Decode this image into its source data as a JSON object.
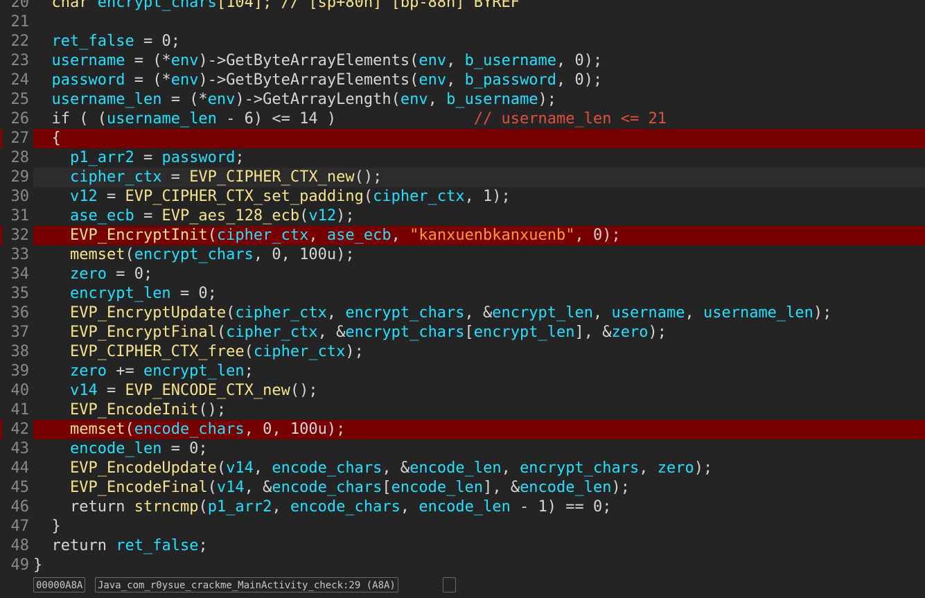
{
  "editor": {
    "lines": [
      {
        "n": "20",
        "bp": false,
        "cur": false,
        "tokens": [
          [
            "  ",
            "op"
          ],
          [
            "char ",
            "ty"
          ],
          [
            "encrypt_chars",
            "var"
          ],
          [
            "[104]; // [sp+80h] [bp-88h] BYREF",
            "fn"
          ]
        ]
      },
      {
        "n": "21",
        "bp": false,
        "cur": false,
        "tokens": []
      },
      {
        "n": "22",
        "bp": false,
        "cur": false,
        "tokens": [
          [
            "  ",
            "op"
          ],
          [
            "ret_false",
            "var"
          ],
          [
            " = 0;",
            "op"
          ]
        ]
      },
      {
        "n": "23",
        "bp": false,
        "cur": false,
        "tokens": [
          [
            "  ",
            "op"
          ],
          [
            "username",
            "var"
          ],
          [
            " = (*",
            "op"
          ],
          [
            "env",
            "var"
          ],
          [
            ")->GetByteArrayElements(",
            "op"
          ],
          [
            "env",
            "var"
          ],
          [
            ", ",
            "op"
          ],
          [
            "b_username",
            "var"
          ],
          [
            ", 0);",
            "op"
          ]
        ]
      },
      {
        "n": "24",
        "bp": false,
        "cur": false,
        "tokens": [
          [
            "  ",
            "op"
          ],
          [
            "password",
            "var"
          ],
          [
            " = (*",
            "op"
          ],
          [
            "env",
            "var"
          ],
          [
            ")->GetByteArrayElements(",
            "op"
          ],
          [
            "env",
            "var"
          ],
          [
            ", ",
            "op"
          ],
          [
            "b_password",
            "var"
          ],
          [
            ", 0);",
            "op"
          ]
        ]
      },
      {
        "n": "25",
        "bp": false,
        "cur": false,
        "tokens": [
          [
            "  ",
            "op"
          ],
          [
            "username_len",
            "var"
          ],
          [
            " = (*",
            "op"
          ],
          [
            "env",
            "var"
          ],
          [
            ")->GetArrayLength(",
            "op"
          ],
          [
            "env",
            "var"
          ],
          [
            ", ",
            "op"
          ],
          [
            "b_username",
            "var"
          ],
          [
            ");",
            "op"
          ]
        ]
      },
      {
        "n": "26",
        "bp": false,
        "cur": false,
        "tokens": [
          [
            "  ",
            "op"
          ],
          [
            "if",
            "kw"
          ],
          [
            " ( (",
            "op"
          ],
          [
            "username_len",
            "var"
          ],
          [
            " - 6) <= 14 )               ",
            "op"
          ],
          [
            "// username_len <= 21",
            "cm"
          ]
        ]
      },
      {
        "n": "27",
        "bp": true,
        "cur": false,
        "tokens": [
          [
            "  {",
            "op"
          ]
        ]
      },
      {
        "n": "28",
        "bp": false,
        "cur": false,
        "tokens": [
          [
            "    ",
            "op"
          ],
          [
            "p1_arr2",
            "var"
          ],
          [
            " = ",
            "op"
          ],
          [
            "password",
            "var"
          ],
          [
            ";",
            "op"
          ]
        ]
      },
      {
        "n": "29",
        "bp": false,
        "cur": true,
        "tokens": [
          [
            "    ",
            "op"
          ],
          [
            "cipher_ctx",
            "var"
          ],
          [
            " = ",
            "op"
          ],
          [
            "EVP_CIPHER_CTX_new",
            "fn"
          ],
          [
            "();",
            "op"
          ]
        ]
      },
      {
        "n": "30",
        "bp": false,
        "cur": false,
        "tokens": [
          [
            "    ",
            "op"
          ],
          [
            "v12",
            "var"
          ],
          [
            " = ",
            "op"
          ],
          [
            "EVP_CIPHER_CTX_set_padding",
            "fn"
          ],
          [
            "(",
            "op"
          ],
          [
            "cipher_ctx",
            "var"
          ],
          [
            ", 1);",
            "op"
          ]
        ]
      },
      {
        "n": "31",
        "bp": false,
        "cur": false,
        "tokens": [
          [
            "    ",
            "op"
          ],
          [
            "ase_ecb",
            "var"
          ],
          [
            " = ",
            "op"
          ],
          [
            "EVP_aes_128_ecb",
            "fn"
          ],
          [
            "(",
            "op"
          ],
          [
            "v12",
            "var"
          ],
          [
            ");",
            "op"
          ]
        ]
      },
      {
        "n": "32",
        "bp": true,
        "cur": false,
        "tokens": [
          [
            "    ",
            "op"
          ],
          [
            "EVP_EncryptInit",
            "fn"
          ],
          [
            "(",
            "op"
          ],
          [
            "cipher_ctx",
            "var"
          ],
          [
            ", ",
            "op"
          ],
          [
            "ase_ecb",
            "var"
          ],
          [
            ", ",
            "op"
          ],
          [
            "\"kanxuenbkanxuenb\"",
            "str"
          ],
          [
            ", 0);",
            "op"
          ]
        ]
      },
      {
        "n": "33",
        "bp": false,
        "cur": false,
        "tokens": [
          [
            "    ",
            "op"
          ],
          [
            "memset",
            "fn"
          ],
          [
            "(",
            "op"
          ],
          [
            "encrypt_chars",
            "var"
          ],
          [
            ", 0, 100u);",
            "op"
          ]
        ]
      },
      {
        "n": "34",
        "bp": false,
        "cur": false,
        "tokens": [
          [
            "    ",
            "op"
          ],
          [
            "zero",
            "var"
          ],
          [
            " = 0;",
            "op"
          ]
        ]
      },
      {
        "n": "35",
        "bp": false,
        "cur": false,
        "tokens": [
          [
            "    ",
            "op"
          ],
          [
            "encrypt_len",
            "var"
          ],
          [
            " = 0;",
            "op"
          ]
        ]
      },
      {
        "n": "36",
        "bp": false,
        "cur": false,
        "tokens": [
          [
            "    ",
            "op"
          ],
          [
            "EVP_EncryptUpdate",
            "fn"
          ],
          [
            "(",
            "op"
          ],
          [
            "cipher_ctx",
            "var"
          ],
          [
            ", ",
            "op"
          ],
          [
            "encrypt_chars",
            "var"
          ],
          [
            ", &",
            "op"
          ],
          [
            "encrypt_len",
            "var"
          ],
          [
            ", ",
            "op"
          ],
          [
            "username",
            "var"
          ],
          [
            ", ",
            "op"
          ],
          [
            "username_len",
            "var"
          ],
          [
            ");",
            "op"
          ]
        ]
      },
      {
        "n": "37",
        "bp": false,
        "cur": false,
        "tokens": [
          [
            "    ",
            "op"
          ],
          [
            "EVP_EncryptFinal",
            "fn"
          ],
          [
            "(",
            "op"
          ],
          [
            "cipher_ctx",
            "var"
          ],
          [
            ", &",
            "op"
          ],
          [
            "encrypt_chars",
            "var"
          ],
          [
            "[",
            "op"
          ],
          [
            "encrypt_len",
            "var"
          ],
          [
            "], &",
            "op"
          ],
          [
            "zero",
            "var"
          ],
          [
            ");",
            "op"
          ]
        ]
      },
      {
        "n": "38",
        "bp": false,
        "cur": false,
        "tokens": [
          [
            "    ",
            "op"
          ],
          [
            "EVP_CIPHER_CTX_free",
            "fn"
          ],
          [
            "(",
            "op"
          ],
          [
            "cipher_ctx",
            "var"
          ],
          [
            ");",
            "op"
          ]
        ]
      },
      {
        "n": "39",
        "bp": false,
        "cur": false,
        "tokens": [
          [
            "    ",
            "op"
          ],
          [
            "zero",
            "var"
          ],
          [
            " += ",
            "op"
          ],
          [
            "encrypt_len",
            "var"
          ],
          [
            ";",
            "op"
          ]
        ]
      },
      {
        "n": "40",
        "bp": false,
        "cur": false,
        "tokens": [
          [
            "    ",
            "op"
          ],
          [
            "v14",
            "var"
          ],
          [
            " = ",
            "op"
          ],
          [
            "EVP_ENCODE_CTX_new",
            "fn"
          ],
          [
            "();",
            "op"
          ]
        ]
      },
      {
        "n": "41",
        "bp": false,
        "cur": false,
        "tokens": [
          [
            "    ",
            "op"
          ],
          [
            "EVP_EncodeInit",
            "fn"
          ],
          [
            "();",
            "op"
          ]
        ]
      },
      {
        "n": "42",
        "bp": true,
        "cur": false,
        "tokens": [
          [
            "    ",
            "op"
          ],
          [
            "memset",
            "fn"
          ],
          [
            "(",
            "op"
          ],
          [
            "encode_chars",
            "var"
          ],
          [
            ", 0, 100u);",
            "op"
          ]
        ]
      },
      {
        "n": "43",
        "bp": false,
        "cur": false,
        "tokens": [
          [
            "    ",
            "op"
          ],
          [
            "encode_len",
            "var"
          ],
          [
            " = 0;",
            "op"
          ]
        ]
      },
      {
        "n": "44",
        "bp": false,
        "cur": false,
        "tokens": [
          [
            "    ",
            "op"
          ],
          [
            "EVP_EncodeUpdate",
            "fn"
          ],
          [
            "(",
            "op"
          ],
          [
            "v14",
            "var"
          ],
          [
            ", ",
            "op"
          ],
          [
            "encode_chars",
            "var"
          ],
          [
            ", &",
            "op"
          ],
          [
            "encode_len",
            "var"
          ],
          [
            ", ",
            "op"
          ],
          [
            "encrypt_chars",
            "var"
          ],
          [
            ", ",
            "op"
          ],
          [
            "zero",
            "var"
          ],
          [
            ");",
            "op"
          ]
        ]
      },
      {
        "n": "45",
        "bp": false,
        "cur": false,
        "tokens": [
          [
            "    ",
            "op"
          ],
          [
            "EVP_EncodeFinal",
            "fn"
          ],
          [
            "(",
            "op"
          ],
          [
            "v14",
            "var"
          ],
          [
            ", &",
            "op"
          ],
          [
            "encode_chars",
            "var"
          ],
          [
            "[",
            "op"
          ],
          [
            "encode_len",
            "var"
          ],
          [
            "], &",
            "op"
          ],
          [
            "encode_len",
            "var"
          ],
          [
            ");",
            "op"
          ]
        ]
      },
      {
        "n": "46",
        "bp": false,
        "cur": false,
        "tokens": [
          [
            "    ",
            "op"
          ],
          [
            "return",
            "kw"
          ],
          [
            " ",
            "op"
          ],
          [
            "strncmp",
            "fn"
          ],
          [
            "(",
            "op"
          ],
          [
            "p1_arr2",
            "var"
          ],
          [
            ", ",
            "op"
          ],
          [
            "encode_chars",
            "var"
          ],
          [
            ", ",
            "op"
          ],
          [
            "encode_len",
            "var"
          ],
          [
            " - 1) == 0;",
            "op"
          ]
        ]
      },
      {
        "n": "47",
        "bp": false,
        "cur": false,
        "tokens": [
          [
            "  }",
            "op"
          ]
        ]
      },
      {
        "n": "48",
        "bp": false,
        "cur": false,
        "tokens": [
          [
            "  ",
            "op"
          ],
          [
            "return",
            "kw"
          ],
          [
            " ",
            "op"
          ],
          [
            "ret_false",
            "var"
          ],
          [
            ";",
            "op"
          ]
        ]
      },
      {
        "n": "49",
        "bp": false,
        "cur": false,
        "tokens": [
          [
            "}",
            "op"
          ]
        ]
      }
    ]
  },
  "status": {
    "address": "00000A8A",
    "location": "Java_com_r0ysue_crackme_MainActivity_check:29 (A8A)",
    "extra": ""
  },
  "colors": {
    "background": "#242424",
    "breakpoint": "#770000",
    "variable": "#23e0ff",
    "function": "#f6e48a",
    "string": "#ff9a2a",
    "comment": "#e0503a",
    "keyword": "#d6d6d6"
  }
}
